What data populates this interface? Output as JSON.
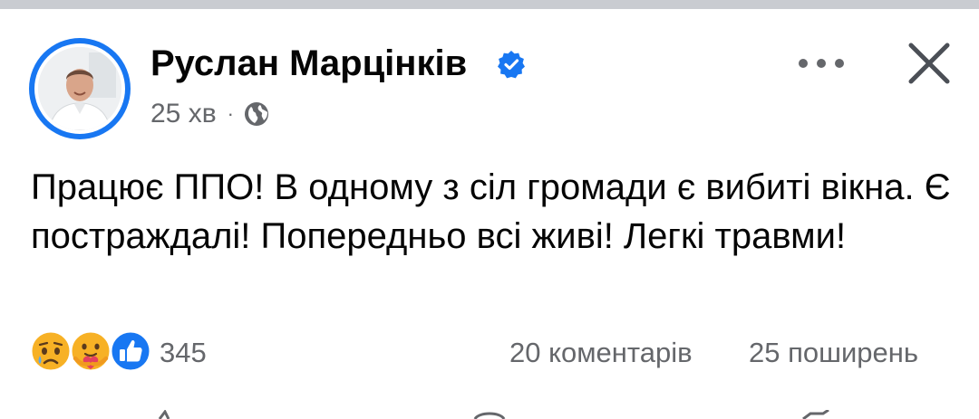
{
  "post": {
    "author": "Руслан Марцінків",
    "verified": true,
    "time": "25 хв",
    "separator": "·",
    "audience_icon": "globe-icon",
    "text": "Працює ППО! В одному з сіл громади є вибиті вікна. Є постраждалі! Попередньо всі живі! Легкі травми!",
    "reactions": {
      "icons": [
        "sad-reaction-icon",
        "care-reaction-icon",
        "like-reaction-icon"
      ],
      "count": "345"
    },
    "comments": "20 коментарів",
    "shares": "25 поширень"
  },
  "colors": {
    "brand_blue": "#1877f2",
    "secondary_text": "#65676b",
    "primary_text": "#050505",
    "divider": "#c9ccd1"
  }
}
